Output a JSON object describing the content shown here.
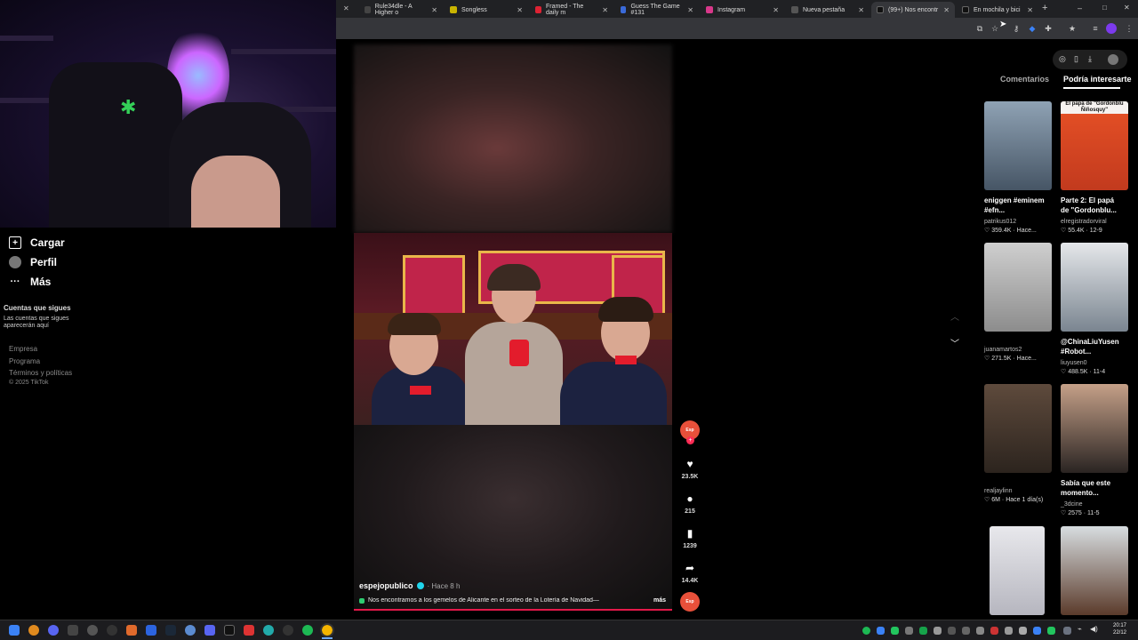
{
  "browser": {
    "tabs": [
      {
        "title": "Rule34dle - A Higher o",
        "fav": "#444"
      },
      {
        "title": "Songless",
        "fav": "#c9b400"
      },
      {
        "title": "Framed - The daily m",
        "fav": "#d23"
      },
      {
        "title": "Guess The Game #131",
        "fav": "#3a6ad9"
      },
      {
        "title": "Instagram",
        "fav": "#d8388a"
      },
      {
        "title": "Nueva pestaña",
        "fav": "#555"
      },
      {
        "title": "(99+) Nos encontr",
        "fav": "#111"
      },
      {
        "title": "En mochila y bici",
        "fav": "#111"
      }
    ],
    "new_tab_label": "+",
    "window_controls": [
      "–",
      "□",
      "✕"
    ]
  },
  "tiktok_nav": {
    "upload_label": "Cargar",
    "profile_label": "Perfil",
    "more_label": "Más",
    "following_title": "Cuentas que sigues",
    "following_empty": "Las cuentas que sigues aparecerán aquí",
    "footer_links": [
      "Empresa",
      "Programa",
      "Términos y políticas"
    ],
    "copyright": "© 2025 TikTok"
  },
  "video": {
    "author": "espejopublico",
    "time": "· Hace 8 h",
    "caption": "Nos encontramos a los gemelos de Alicante en el sorteo de la Lotería de Navidad—",
    "more_label": "más",
    "likes": "23.5K",
    "comments": "215",
    "saves": "1239",
    "shares": "14.4K",
    "creator_badge": "Esp"
  },
  "right_panel": {
    "tabs": [
      "Comentarios",
      "Podría interesarte"
    ],
    "cards": [
      {
        "title": "eniggen #eminem #efn...",
        "author": "patrikus012",
        "likes": "359.4K",
        "time": "Hace...",
        "thumb_top": "#8fa2b4",
        "thumb_bottom": "#465565",
        "thumb_text": ""
      },
      {
        "title": "Parte 2: El papá de \"Gordonblu...",
        "author": "elregistradorviral",
        "likes": "55.4K",
        "time": "12-9",
        "thumb_top": "#f6f2f0",
        "thumb_bottom": "#e24e25",
        "thumb_text": "El papá de \"Gordonblu Ñiñosquy\""
      },
      {
        "title": "",
        "author": "juanamartos2",
        "likes": "271.5K",
        "time": "Hace...",
        "thumb_top": "#cfcfcf",
        "thumb_bottom": "#8c8c8c",
        "thumb_text": ""
      },
      {
        "title": "@ChinaLiuYusen #Robot...",
        "author": "liuyusen0",
        "likes": "488.5K",
        "time": "11-4",
        "thumb_top": "#e5e7ea",
        "thumb_bottom": "#7a8590",
        "thumb_text": ""
      },
      {
        "title": "",
        "author": "realjaylinn",
        "likes": "6M",
        "time": "Hace 1 día(s)",
        "thumb_top": "#5e4a3c",
        "thumb_bottom": "#2c241e",
        "thumb_text": ""
      },
      {
        "title": "Sabía que este momento...",
        "author": "_3dcine",
        "likes": "2575",
        "time": "11-5",
        "thumb_top": "#c5a088",
        "thumb_bottom": "#2a2422",
        "thumb_text": ""
      },
      {
        "title": "",
        "author": "",
        "likes": "",
        "time": "",
        "thumb_top": "#e8e8ec",
        "thumb_bottom": "#b6b6bf",
        "thumb_text": ""
      },
      {
        "title": "",
        "author": "",
        "likes": "",
        "time": "",
        "thumb_top": "#d7dde0",
        "thumb_bottom": "#5b3b2b",
        "thumb_text": ""
      }
    ]
  },
  "taskbar": {
    "time": "20:17",
    "date": "22/12"
  },
  "colors": {
    "accent": "#fe2c55",
    "avatar": "#e8503a"
  }
}
